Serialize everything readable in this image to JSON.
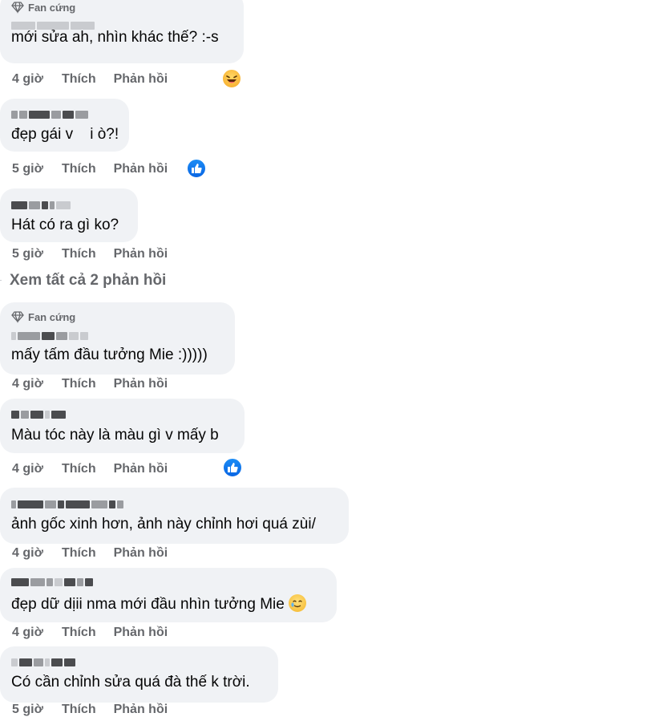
{
  "comments": [
    {
      "badge": "Fan cứng",
      "text": "mới sửa ah, nhìn khác thế? :-s",
      "time": "4 giờ",
      "like": "Thích",
      "reply": "Phản hồi",
      "reaction": "haha-reaction-icon"
    },
    {
      "badge": "",
      "text": "đẹp gái v    i ò?!",
      "time": "5 giờ",
      "like": "Thích",
      "reply": "Phản hồi",
      "reaction": "like-reaction-icon"
    },
    {
      "badge": "",
      "text": "Hát có ra gì ko?",
      "time": "5 giờ",
      "like": "Thích",
      "reply": "Phản hồi",
      "reaction": ""
    },
    {
      "badge": "Fan cứng",
      "text": "mấy tấm đầu tưởng Mie :)))))",
      "time": "4 giờ",
      "like": "Thích",
      "reply": "Phản hồi",
      "reaction": ""
    },
    {
      "badge": "",
      "text": "Màu tóc này là màu gì v mấy b",
      "time": "4 giờ",
      "like": "Thích",
      "reply": "Phản hồi",
      "reaction": "like-reaction-icon"
    },
    {
      "badge": "",
      "text": "ảnh gốc xinh hơn, ảnh này chỉnh hơi quá zùi/",
      "time": "4 giờ",
      "like": "Thích",
      "reply": "Phản hồi",
      "reaction": ""
    },
    {
      "badge": "",
      "text": "đẹp dữ dịii nma mới đầu nhìn tưởng Mie",
      "time": "4 giờ",
      "like": "Thích",
      "reply": "Phản hồi",
      "reaction": "",
      "emoji": "tear-smile-emoji"
    },
    {
      "badge": "",
      "text": "Có cần chỉnh sửa quá đà thế k trời.",
      "time": "5 giờ",
      "like": "Thích",
      "reply": "Phản hồi",
      "reaction": ""
    }
  ],
  "view_more": "Xem tất cả 2 phản hồi",
  "colors": {
    "bubble": "#f0f2f5",
    "secondary_text": "#65676b",
    "like_blue": "#0a66e4"
  }
}
